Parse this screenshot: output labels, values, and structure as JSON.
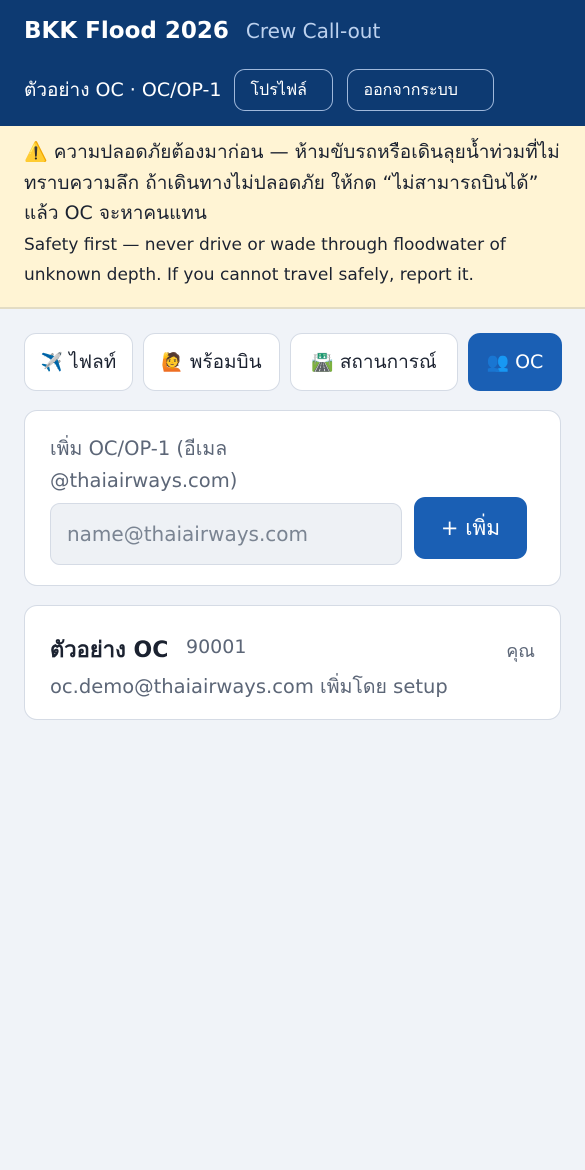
{
  "header": {
    "title": "BKK Flood 2026",
    "subtitle": "Crew Call-out",
    "user_label": "ตัวอย่าง OC · OC/OP-1",
    "profile_button": "โปรไฟล์",
    "logout_button": "ออกจากระบบ"
  },
  "alert": {
    "icon": "⚠️",
    "thai_text": "ความปลอดภัยต้องมาก่อน — ห้ามขับรถหรือเดินลุยน้ำท่วมที่ไม่ทราบความลึก ถ้าเดินทางไม่ปลอดภัย ให้กด “ไม่สามารถบินได้” แล้ว OC จะหาคนแทน",
    "english_text": "Safety first — never drive or wade through floodwater of unknown depth. If you cannot travel safely, report it."
  },
  "tabs": [
    {
      "icon": "✈️",
      "label": "ไฟลท์",
      "active": false
    },
    {
      "icon": "🙋",
      "label": "พร้อมบิน",
      "active": false
    },
    {
      "icon": "🛣️",
      "label": "สถานการณ์",
      "active": false
    },
    {
      "icon": "👥",
      "label": "OC",
      "active": true
    }
  ],
  "add_oc": {
    "label": "เพิ่ม OC/OP-1 (อีเมล @thaiairways.com)",
    "placeholder": "name@thaiairways.com",
    "value": "",
    "button": "+ เพิ่ม"
  },
  "oc_list": [
    {
      "name": "ตัวอย่าง OC",
      "staff_id": "90001",
      "you_badge": "คุณ",
      "email_line": "oc.demo@thaiairways.com เพิ่มโดย setup"
    }
  ],
  "colors": {
    "header_bg": "#0d3a72",
    "accent": "#1a5fb4",
    "alert_bg": "#fff4d4",
    "page_bg": "#f0f3f8"
  }
}
